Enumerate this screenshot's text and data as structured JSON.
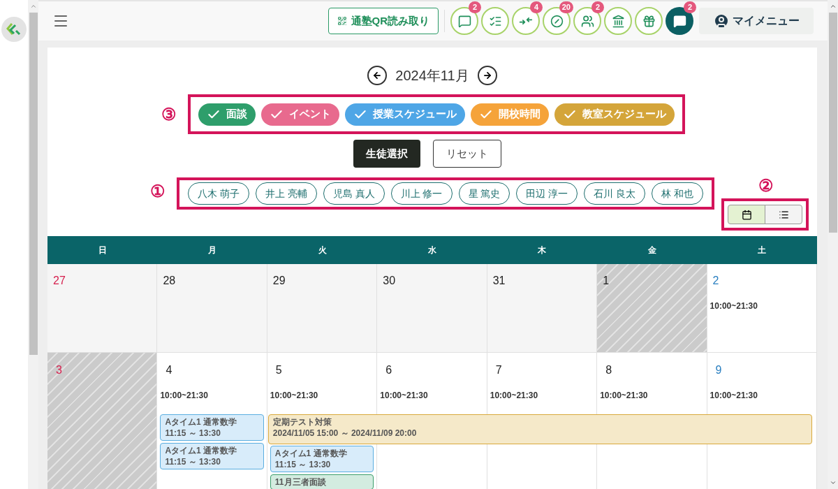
{
  "header": {
    "qr_button": "通塾QR読み取り",
    "icon_buttons": [
      {
        "kind": "message",
        "badge": "2"
      },
      {
        "kind": "checklist"
      },
      {
        "kind": "arrows",
        "badge": "4"
      },
      {
        "kind": "blocked",
        "badge": "20"
      },
      {
        "kind": "group",
        "badge": "2"
      },
      {
        "kind": "building"
      },
      {
        "kind": "gift"
      },
      {
        "kind": "chat",
        "badge": "2"
      }
    ],
    "my_menu": "マイメニュー"
  },
  "month": "2024年11月",
  "filters_marker": "③",
  "filters": [
    {
      "label": "面談",
      "color": "#2e9e6b",
      "checked": true
    },
    {
      "label": "イベント",
      "color": "#e86a8e",
      "checked": true
    },
    {
      "label": "授業スケジュール",
      "color": "#4ea6e6",
      "checked": true
    },
    {
      "label": "開校時間",
      "color": "#f5a33a",
      "checked": true
    },
    {
      "label": "教室スケジュール",
      "color": "#d4a53a",
      "checked": true
    }
  ],
  "select_button": "生徒選択",
  "reset_button": "リセット",
  "students_marker": "①",
  "students": [
    {
      "name": "八木 萌子",
      "selected": false
    },
    {
      "name": "井上 亮輔",
      "selected": false
    },
    {
      "name": "児島 真人",
      "selected": false
    },
    {
      "name": "川上 修一",
      "selected": false
    },
    {
      "name": "星 篤史",
      "selected": false
    },
    {
      "name": "田辺 淳一",
      "selected": false
    },
    {
      "name": "石川 良太",
      "selected": false
    },
    {
      "name": "林 和也",
      "selected": false
    }
  ],
  "view_marker": "②",
  "views": [
    {
      "kind": "calendar",
      "selected": true
    },
    {
      "kind": "list",
      "selected": false
    }
  ],
  "weekdays": [
    "日",
    "月",
    "火",
    "水",
    "木",
    "金",
    "土"
  ],
  "weeks": [
    {
      "days": [
        {
          "date": "27",
          "kind": "outside"
        },
        {
          "date": "28",
          "kind": "outside"
        },
        {
          "date": "29",
          "kind": "outside"
        },
        {
          "date": "30",
          "kind": "outside"
        },
        {
          "date": "31",
          "kind": "outside"
        },
        {
          "date": "1",
          "kind": "closed"
        },
        {
          "date": "2",
          "kind": "open",
          "hours": "10:00~21:30"
        }
      ]
    },
    {
      "days": [
        {
          "date": "3",
          "kind": "closed"
        },
        {
          "date": "4",
          "kind": "open",
          "hours": "10:00~21:30",
          "events": [
            {
              "kind": "lesson",
              "title": "Aタイム1 通常数学",
              "time": "11:15 ～ 13:30"
            },
            {
              "kind": "lesson",
              "title": "Aタイム1 通常数学",
              "time": "11:15 ～ 13:30"
            }
          ]
        },
        {
          "date": "5",
          "kind": "open",
          "hours": "10:00~21:30",
          "banner": {
            "title": "定期テスト対策",
            "time": "2024/11/05 15:00 ～ 2024/11/09 20:00",
            "to_week_end": true
          },
          "events": [
            {
              "kind": "lesson",
              "title": "Aタイム1 通常数学",
              "time": "11:15 ～ 13:30"
            },
            {
              "kind": "meeting",
              "title": "11月三者面談"
            }
          ]
        },
        {
          "date": "6",
          "kind": "open",
          "hours": "10:00~21:30"
        },
        {
          "date": "7",
          "kind": "open",
          "hours": "10:00~21:30"
        },
        {
          "date": "8",
          "kind": "open",
          "hours": "10:00~21:30"
        },
        {
          "date": "9",
          "kind": "open",
          "hours": "10:00~21:30"
        }
      ]
    }
  ]
}
